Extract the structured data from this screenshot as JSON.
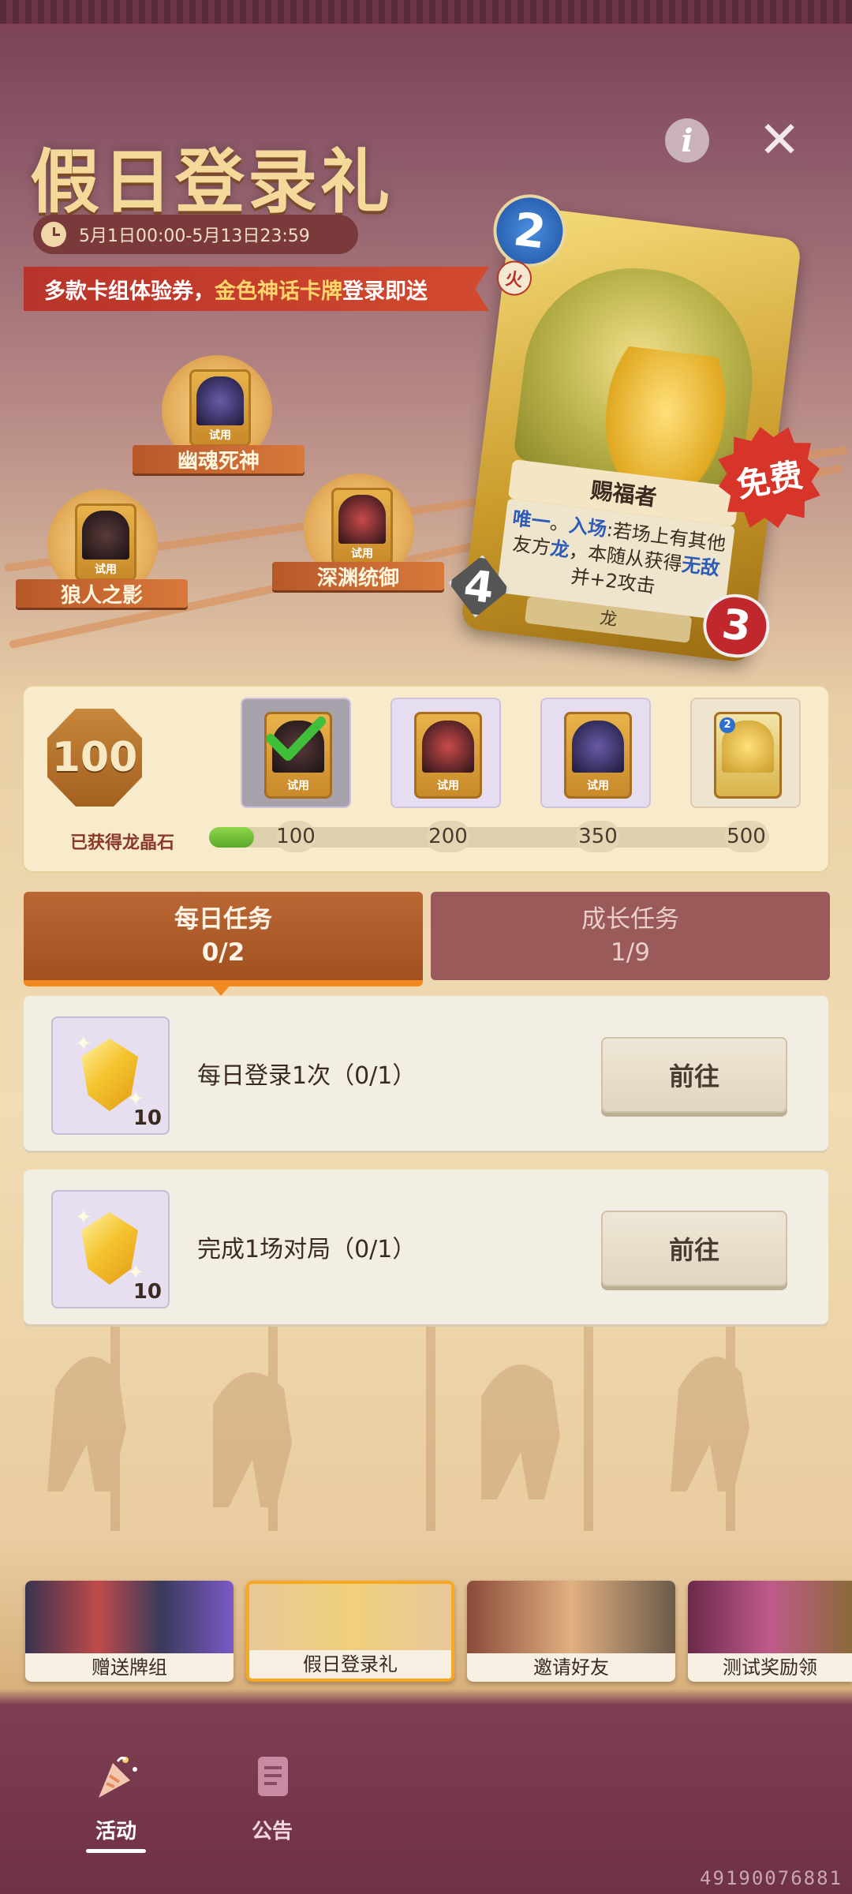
{
  "header": {
    "title": "假日登录礼",
    "date_range": "5月1日00:00-5月13日23:59",
    "banner_prefix": "多款卡组体验券，",
    "banner_highlight": "金色神话卡牌",
    "banner_suffix": "登录即送",
    "info_icon": "i",
    "close_icon": "✕"
  },
  "decks": [
    {
      "label": "幽魂死神",
      "tag": "试用"
    },
    {
      "label": "狼人之影",
      "tag": "试用"
    },
    {
      "label": "深渊统御",
      "tag": "试用"
    }
  ],
  "featured_card": {
    "cost": "2",
    "element": "火",
    "name": "赐福者",
    "text_kw1": "唯一",
    "text_sep": "。",
    "text_kw2": "入场",
    "text_mid": ":若场上有其他友方",
    "text_kw3": "龙",
    "text_mid2": "，本随从获得",
    "text_kw4": "无敌",
    "text_end": "并+2攻击",
    "tribe": "龙",
    "attack": "4",
    "health": "3",
    "free_badge": "免费"
  },
  "progress": {
    "crystals": "100",
    "crystals_label": "已获得龙晶石",
    "fill_fraction": 0.08,
    "milestones": [
      {
        "value": "100",
        "tag": "试用",
        "claimed": true
      },
      {
        "value": "200",
        "tag": "试用",
        "claimed": false
      },
      {
        "value": "350",
        "tag": "试用",
        "claimed": false
      },
      {
        "value": "500",
        "card_cost": "2",
        "claimed": false
      }
    ]
  },
  "tabs": [
    {
      "label": "每日任务",
      "count": "0/2",
      "active": true
    },
    {
      "label": "成长任务",
      "count": "1/9",
      "active": false
    }
  ],
  "tasks": [
    {
      "desc": "每日登录1次（0/1）",
      "reward": "10",
      "button": "前往"
    },
    {
      "desc": "完成1场对局（0/1）",
      "reward": "10",
      "button": "前往"
    }
  ],
  "events": [
    {
      "label": "赠送牌组"
    },
    {
      "label": "假日登录礼"
    },
    {
      "label": "邀请好友"
    },
    {
      "label": "测试奖励领"
    }
  ],
  "nav": [
    {
      "label": "活动",
      "icon": "party-popper-icon"
    },
    {
      "label": "公告",
      "icon": "document-icon"
    }
  ],
  "serial": "49190076881"
}
